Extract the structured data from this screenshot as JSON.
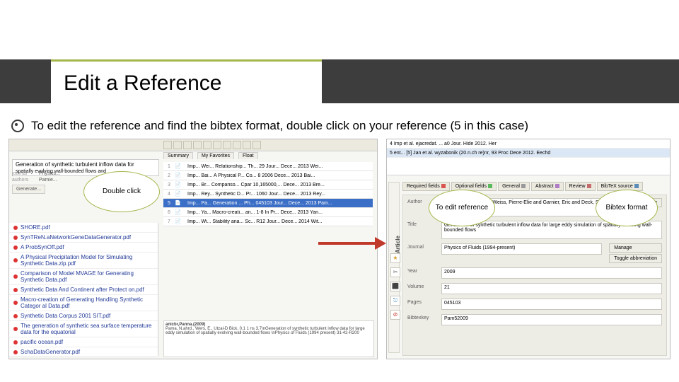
{
  "slide": {
    "title": "Edit a Reference",
    "bullet": "To edit the reference and find the bibtex format, double click on your reference (5 in this case)"
  },
  "callouts": {
    "double_click": "Double click",
    "to_edit": "To edit reference",
    "bibtex": "Bibtex format"
  },
  "left_panel": {
    "record_title": "Generation of synthetic turbulent inflow data for",
    "record_sub": "spatially evolving wall-bounded flows and",
    "meta_labels": {
      "journal": "journal",
      "authors": "authors",
      "generate": "Generate..."
    },
    "meta_values": {
      "journal": "Physics...",
      "authors": "Pamie..."
    },
    "tabs": [
      "Summary",
      "My Favorites",
      "Float"
    ],
    "rows": [
      {
        "n": "1",
        "sel": false,
        "text": "Imp...  Wei...  Relationship...  Th... 29  Jour... Dece... 2013  Wei..."
      },
      {
        "n": "2",
        "sel": false,
        "text": "Imp...  Bai...  A Physical P...  Co... 8  2006  Dece... 2013  Bai..."
      },
      {
        "n": "3",
        "sel": false,
        "text": "Imp...  Br...  Compariso...  Cpar 10,165000,...  Dece... 2013  Bre..."
      },
      {
        "n": "4",
        "sel": false,
        "text": "Imp...  Rey...  Synthetic D...  Pr... 1060  Jour... Dece... 2013  Rey..."
      },
      {
        "n": "5",
        "sel": true,
        "text": "Imp...  Pa...  Generation ...  Ph... 045103  Jour... Dece... 2013  Pam..."
      },
      {
        "n": "6",
        "sel": false,
        "text": "Imp...  Ya...  Macro-creati...  an... 1-8  In Pr... Dece... 2013  Yan..."
      },
      {
        "n": "7",
        "sel": false,
        "text": "Imp...  Wi...  Stability ana...  Sc... R12  Jour... Dece... 2014  Wit..."
      }
    ],
    "files": [
      "SHORE.pdf",
      "SynTReN.aNetworkGeneDataGenerator.pdf",
      "A ProbSynOff.pdf",
      "A Physical Precipitation Model for Simulating Synthetic Data.zip.pdf",
      "Comparison of Model MVAGE for Generating Synthetic Data.pdf",
      "Synthetic Data And Continent after Protect on.pdf",
      "Macro-creation of Generating Handling Synthetic Categor al Data.pdf",
      "Synthetic Data Corpus 2001 SIT.pdf",
      "The generation of synthetic sea surface temperature data for the equatorial",
      "pacific ocean.pdf",
      "SchaDataGenerator.pdf"
    ],
    "preview_title": "anicbr,Panna.(2009)",
    "preview_body": "Pama, N.ahrd., Wers, E., Utzal-D Bick, 0.1 1 ns 3.7\\nGeneration of synthetic turbulent inflow data for large eddy simulation of spatially evolving wall-bounded flows \\nPhysics of Fluids (1994 present)  31-42-R200"
  },
  "right_panel": {
    "top_rows": [
      "4   Imp   et al.    ejacredat.          ...  a0            Jour.  Hide   2012.   Her",
      "5   ent...  [5] Jan et al.    wyzabonik (20.n.ch re)nr,   93     Proc   Dece   2012.   Eechd"
    ],
    "vert_label": "Article",
    "tabs": [
      {
        "label": "Required fields",
        "color": "#d9534f"
      },
      {
        "label": "Optional fields",
        "color": "#5cb85c"
      },
      {
        "label": "General",
        "color": "#999"
      },
      {
        "label": "Abstract",
        "color": "#b07cc6"
      },
      {
        "label": "Review",
        "color": "#c46b6b"
      },
      {
        "label": "BibTeX source",
        "color": "#5b8db8"
      }
    ],
    "btn_manage": "Manage",
    "btn_toggle": "Toggle abbreviation",
    "fields": {
      "author": {
        "label": "Author",
        "value": "Parmes, Mathieu and Weiss, Pierre-Elie and Garnier, Eric and Deck, Sébastien and Sagaut, Pierre"
      },
      "title": {
        "label": "Title",
        "value": "Generation of synthetic turbulent inflow data for large eddy simulation of spatially-evolving wall-bounded flows"
      },
      "journal": {
        "label": "Journal",
        "value": "Physics of Fluids (1994-present)"
      },
      "year": {
        "label": "Year",
        "value": "2009"
      },
      "volume": {
        "label": "Volume",
        "value": "21"
      },
      "pages": {
        "label": "Pages",
        "value": "045103"
      },
      "bibtexkey": {
        "label": "Bibtexkey",
        "value": "Pam52009"
      }
    }
  }
}
